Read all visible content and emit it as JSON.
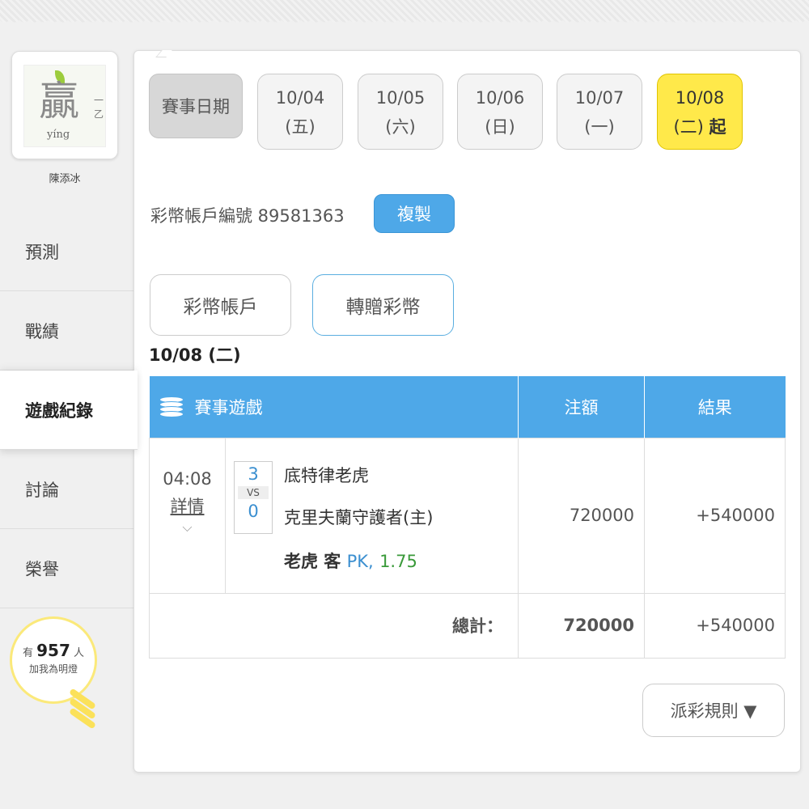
{
  "sidebar": {
    "avatar": {
      "char": "贏",
      "pinyin": "yíng",
      "side_mark": "一乙"
    },
    "username": "陳添冰",
    "items": [
      {
        "label": "預測"
      },
      {
        "label": "戰績"
      },
      {
        "label": "遊戲紀錄"
      },
      {
        "label": "討論"
      },
      {
        "label": "榮譽"
      }
    ],
    "bulb": {
      "prefix": "有",
      "count": "957",
      "suffix": "人",
      "line2": "加我為明燈"
    }
  },
  "dates": {
    "label": "賽事日期",
    "items": [
      {
        "date": "10/04",
        "dow": "(五)"
      },
      {
        "date": "10/05",
        "dow": "(六)"
      },
      {
        "date": "10/06",
        "dow": "(日)"
      },
      {
        "date": "10/07",
        "dow": "(一)"
      },
      {
        "date": "10/08",
        "dow": "(二)",
        "suffix": "起"
      }
    ]
  },
  "account": {
    "label": "彩幣帳戶編號 89581363",
    "copy_button": "複製"
  },
  "tabs": [
    {
      "label": "彩幣帳戶"
    },
    {
      "label": "轉贈彩幣"
    }
  ],
  "selected_date": "10/08 (二)",
  "table": {
    "headers": {
      "game": "賽事遊戲",
      "amount": "注額",
      "result": "結果"
    },
    "rows": [
      {
        "time": "04:08",
        "detail": "詳情",
        "score_away": "3",
        "vs": "VS",
        "score_home": "0",
        "team_away": "底特律老虎",
        "team_home": "克里夫蘭守護者(主)",
        "pick_team": "老虎 客",
        "pick_type": "PK,",
        "odds": "1.75",
        "amount": "720000",
        "result": "+540000"
      }
    ],
    "total": {
      "label": "總計：",
      "amount": "720000",
      "result": "+540000"
    }
  },
  "rules_button": "派彩規則 ▼",
  "colors": {
    "accent": "#4ea8e8",
    "highlight": "#ffe94a",
    "win": "#3a9a3a"
  }
}
